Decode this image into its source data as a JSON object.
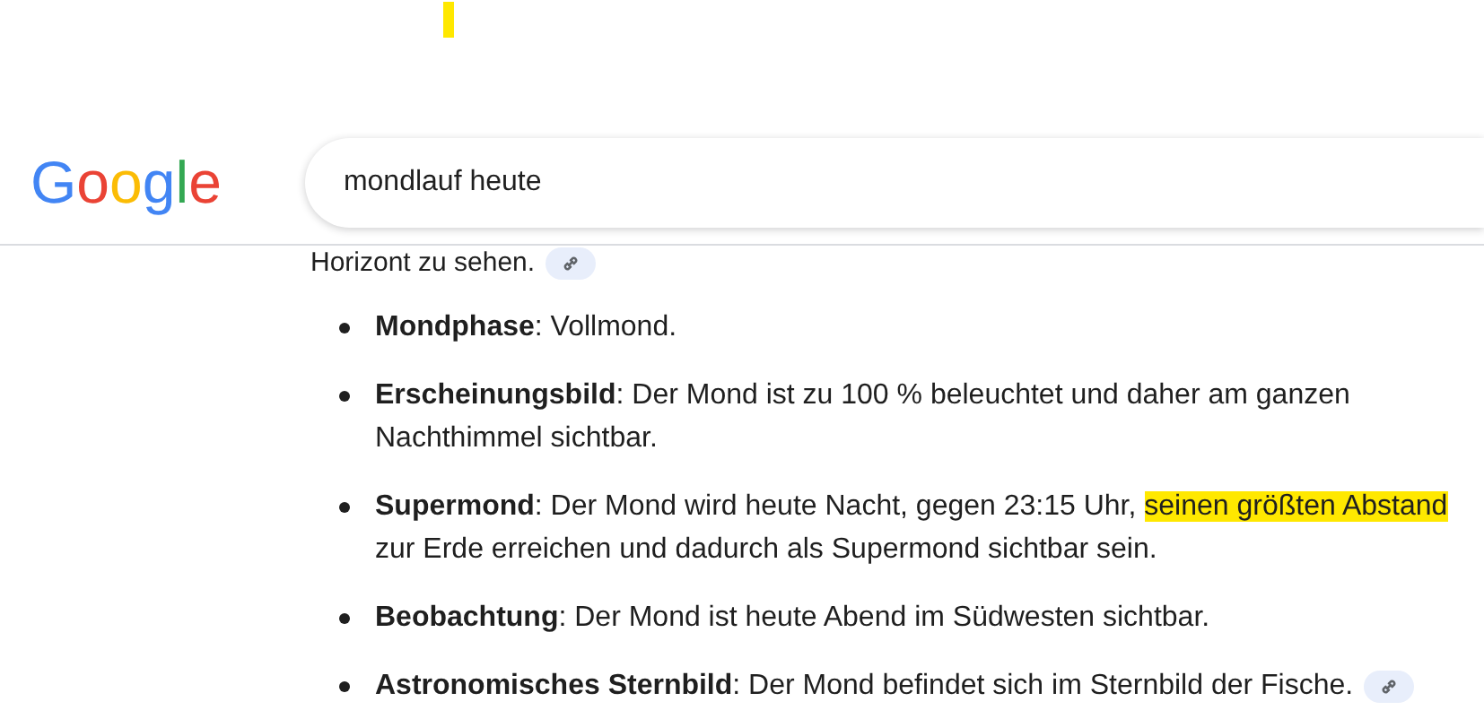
{
  "annotations": [
    {
      "kind": "marker-stroke"
    }
  ],
  "header": {
    "logo": "Google",
    "query": "mondlauf heute"
  },
  "result": {
    "intro_tail": {
      "text": "Horizont zu sehen.",
      "link_chip": true
    },
    "items": [
      {
        "segments": [
          {
            "text": "**Mondphase**: Vollmond.",
            "highlighted": false
          }
        ],
        "link_chip": false
      },
      {
        "segments": [
          {
            "text": "**Erscheinungsbild**: Der Mond ist zu 100 % beleuchtet und daher am ganzen Nachthimmel sichtbar.",
            "highlighted": false
          }
        ],
        "link_chip": false
      },
      {
        "segments": [
          {
            "text": "**Supermond**: Der Mond wird heute Nacht, gegen 23:15 Uhr, ",
            "highlighted": false
          },
          {
            "text": "seinen größten Abstand",
            "highlighted": true
          },
          {
            "text": " zur Erde erreichen und dadurch als Supermond sichtbar sein.",
            "highlighted": false
          }
        ],
        "link_chip": false
      },
      {
        "segments": [
          {
            "text": "**Beobachtung**: Der Mond ist heute Abend im Südwesten sichtbar.",
            "highlighted": false
          }
        ],
        "link_chip": false
      },
      {
        "segments": [
          {
            "text": "**Astronomisches Sternbild**: Der Mond befindet sich im Sternbild der Fische.",
            "highlighted": false
          }
        ],
        "link_chip": true
      }
    ]
  }
}
